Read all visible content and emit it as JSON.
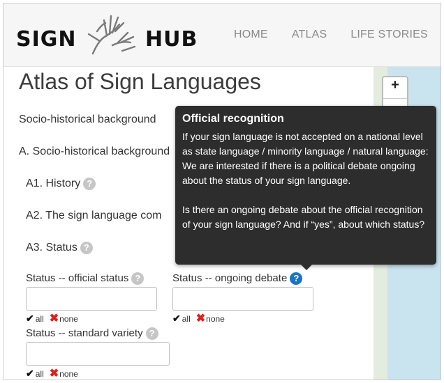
{
  "brand": {
    "left": "SIGN",
    "right": "HUB"
  },
  "nav": [
    "HOME",
    "ATLAS",
    "LIFE STORIES"
  ],
  "page": {
    "title": "Atlas of Sign Languages"
  },
  "sections": {
    "socio": "Socio-historical background",
    "a": "A. Socio-historical background",
    "a1": "A1. History",
    "a2": "A2. The sign language com",
    "a3": "A3. Status"
  },
  "fields": {
    "official": {
      "label": "Status -- official status",
      "value": ""
    },
    "debate": {
      "label": "Status -- ongoing debate",
      "value": ""
    },
    "standard": {
      "label": "Status -- standard variety",
      "value": ""
    },
    "next_partial": "Status -- standard variety"
  },
  "filters": {
    "all": "all",
    "none": "none"
  },
  "map": {
    "zoom_in": "+"
  },
  "tooltip": {
    "title": "Official recognition",
    "p1": "If your sign language is not accepted on a national level as state language / minority language / natural language: We are interested if there is a political debate ongoing about the status of your sign language.",
    "p2": "Is there an ongoing debate about the official recognition of your sign language? And if “yes”, about which status?"
  },
  "icons": {
    "help": "?",
    "check": "✔",
    "cross": "✖"
  },
  "colors": {
    "help_active": "#1a73c8",
    "none_x": "#e0201c",
    "tooltip_bg": "#2d2d2d"
  }
}
